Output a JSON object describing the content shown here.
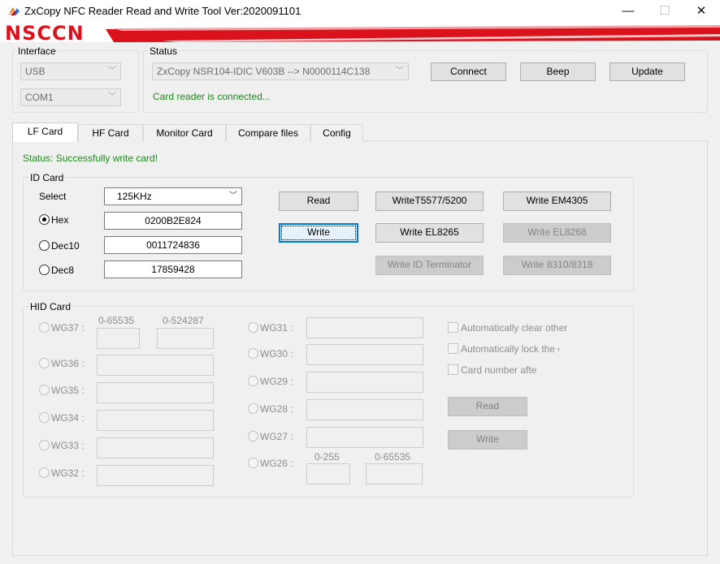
{
  "window": {
    "title": "ZxCopy NFC Reader Read and Write Tool  Ver:2020091101",
    "minimize_glyph": "—",
    "maximize_glyph": "☐",
    "close_glyph": "✕"
  },
  "banner": {
    "logo_text": "NSCCN",
    "accent_color": "#d9121c"
  },
  "interface": {
    "title": "Interface",
    "port_type": "USB",
    "com_port": "COM1"
  },
  "status_box": {
    "title": "Status",
    "device": "ZxCopy NSR104-IDIC V603B --> N0000114C138",
    "message": "Card reader is connected...",
    "connect": "Connect",
    "beep": "Beep",
    "update": "Update"
  },
  "tabs": [
    "LF Card",
    "HF Card",
    "Monitor Card",
    "Compare files",
    "Config"
  ],
  "lf": {
    "status": "Status: Successfully write card!",
    "id_card": {
      "title": "ID Card",
      "select_label": "Select",
      "frequency": "125KHz",
      "hex_label": "Hex",
      "hex_value": "0200B2E824",
      "dec10_label": "Dec10",
      "dec10_value": "0011724836",
      "dec8_label": "Dec8",
      "dec8_value": "17859428",
      "read": "Read",
      "write": "Write",
      "write_t5577": "WriteT5577/5200",
      "write_em4305": "Write EM4305",
      "write_el8265": "Write EL8265",
      "write_el8268": "Write EL8268",
      "write_id_terminator": "Write ID Terminator",
      "write_8310": "Write 8310/8318"
    },
    "hid_card": {
      "title": "HID Card",
      "wg37": "WG37 :",
      "wg37_range1": "0-65535",
      "wg37_range2": "0-524287",
      "wg36": "WG36 :",
      "wg35": "WG35 :",
      "wg34": "WG34 :",
      "wg33": "WG33 :",
      "wg32": "WG32 :",
      "wg31": "WG31 :",
      "wg30": "WG30 :",
      "wg29": "WG29 :",
      "wg28": "WG28 :",
      "wg27": "WG27 :",
      "wg26": "WG26 :",
      "wg26_range1": "0-255",
      "wg26_range2": "0-65535",
      "auto_clear": "Automatically clear other",
      "auto_lock": "Automatically lock the c",
      "card_number": "Card number afte",
      "read": "Read",
      "write": "Write"
    }
  }
}
